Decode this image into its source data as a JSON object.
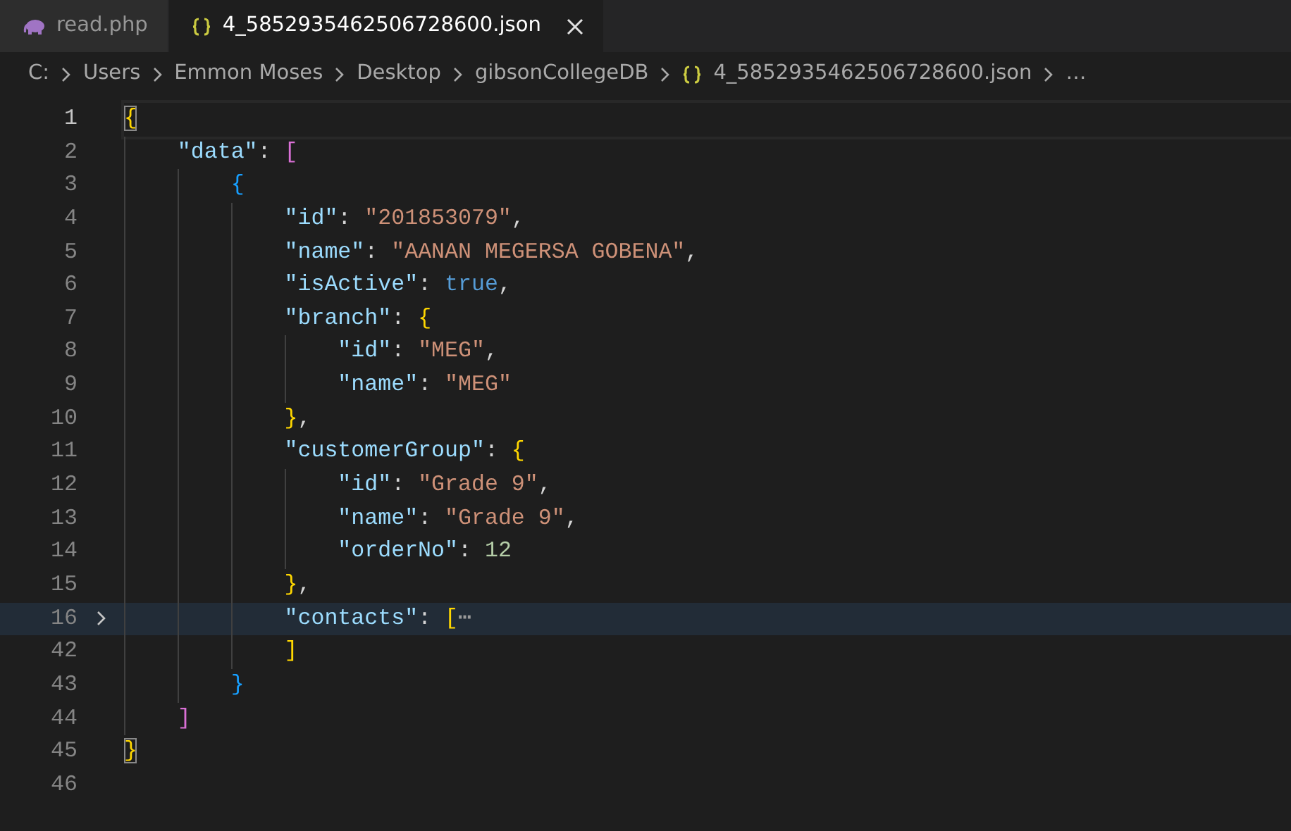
{
  "tabs": [
    {
      "label": "read.php",
      "kind": "php",
      "selected": false,
      "closable": false
    },
    {
      "label": "4_5852935462506728600.json",
      "kind": "json",
      "selected": true,
      "closable": true
    }
  ],
  "breadcrumb": [
    {
      "label": "C:",
      "kind": "folder"
    },
    {
      "label": "Users",
      "kind": "folder"
    },
    {
      "label": "Emmon Moses",
      "kind": "folder"
    },
    {
      "label": "Desktop",
      "kind": "folder"
    },
    {
      "label": "gibsonCollegeDB",
      "kind": "folder"
    },
    {
      "label": "4_5852935462506728600.json",
      "kind": "json"
    },
    {
      "label": "…",
      "kind": "more"
    }
  ],
  "editor": {
    "lines": [
      {
        "number": "1",
        "cursor": true,
        "highlighted": false,
        "folded": false,
        "tokens": [
          {
            "kind": "bracket",
            "text": "{",
            "color": "#ffd700",
            "matched": true
          }
        ],
        "children": [
          {
            "number": "2",
            "cursor": false,
            "highlighted": false,
            "folded": false,
            "tokens": [
              {
                "kind": "key",
                "text": "\"data\""
              },
              {
                "kind": "punct",
                "text": ": "
              },
              {
                "kind": "bracket",
                "text": "[",
                "color": "#da70d6",
                "matched": false
              }
            ],
            "children": [
              {
                "number": "3",
                "cursor": false,
                "highlighted": false,
                "folded": false,
                "tokens": [
                  {
                    "kind": "bracket",
                    "text": "{",
                    "color": "#179fff",
                    "matched": false
                  }
                ],
                "children": [
                  {
                    "number": "4",
                    "cursor": false,
                    "highlighted": false,
                    "folded": false,
                    "tokens": [
                      {
                        "kind": "key",
                        "text": "\"id\""
                      },
                      {
                        "kind": "punct",
                        "text": ": "
                      },
                      {
                        "kind": "string",
                        "text": "\"201853079\""
                      },
                      {
                        "kind": "punct",
                        "text": ","
                      }
                    ]
                  },
                  {
                    "number": "5",
                    "cursor": false,
                    "highlighted": false,
                    "folded": false,
                    "tokens": [
                      {
                        "kind": "key",
                        "text": "\"name\""
                      },
                      {
                        "kind": "punct",
                        "text": ": "
                      },
                      {
                        "kind": "string",
                        "text": "\"AANAN MEGERSA GOBENA\""
                      },
                      {
                        "kind": "punct",
                        "text": ","
                      }
                    ]
                  },
                  {
                    "number": "6",
                    "cursor": false,
                    "highlighted": false,
                    "folded": false,
                    "tokens": [
                      {
                        "kind": "key",
                        "text": "\"isActive\""
                      },
                      {
                        "kind": "punct",
                        "text": ": "
                      },
                      {
                        "kind": "keyword",
                        "text": "true"
                      },
                      {
                        "kind": "punct",
                        "text": ","
                      }
                    ]
                  },
                  {
                    "number": "7",
                    "cursor": false,
                    "highlighted": false,
                    "folded": false,
                    "tokens": [
                      {
                        "kind": "key",
                        "text": "\"branch\""
                      },
                      {
                        "kind": "punct",
                        "text": ": "
                      },
                      {
                        "kind": "bracket",
                        "text": "{",
                        "color": "#ffd700",
                        "matched": false
                      }
                    ],
                    "children": [
                      {
                        "number": "8",
                        "cursor": false,
                        "highlighted": false,
                        "folded": false,
                        "tokens": [
                          {
                            "kind": "key",
                            "text": "\"id\""
                          },
                          {
                            "kind": "punct",
                            "text": ": "
                          },
                          {
                            "kind": "string",
                            "text": "\"MEG\""
                          },
                          {
                            "kind": "punct",
                            "text": ","
                          }
                        ]
                      },
                      {
                        "number": "9",
                        "cursor": false,
                        "highlighted": false,
                        "folded": false,
                        "tokens": [
                          {
                            "kind": "key",
                            "text": "\"name\""
                          },
                          {
                            "kind": "punct",
                            "text": ": "
                          },
                          {
                            "kind": "string",
                            "text": "\"MEG\""
                          }
                        ]
                      }
                    ]
                  },
                  {
                    "number": "10",
                    "cursor": false,
                    "highlighted": false,
                    "folded": false,
                    "tokens": [
                      {
                        "kind": "bracket",
                        "text": "}",
                        "color": "#ffd700",
                        "matched": false
                      },
                      {
                        "kind": "punct",
                        "text": ","
                      }
                    ]
                  },
                  {
                    "number": "11",
                    "cursor": false,
                    "highlighted": false,
                    "folded": false,
                    "tokens": [
                      {
                        "kind": "key",
                        "text": "\"customerGroup\""
                      },
                      {
                        "kind": "punct",
                        "text": ": "
                      },
                      {
                        "kind": "bracket",
                        "text": "{",
                        "color": "#ffd700",
                        "matched": false
                      }
                    ],
                    "children": [
                      {
                        "number": "12",
                        "cursor": false,
                        "highlighted": false,
                        "folded": false,
                        "tokens": [
                          {
                            "kind": "key",
                            "text": "\"id\""
                          },
                          {
                            "kind": "punct",
                            "text": ": "
                          },
                          {
                            "kind": "string",
                            "text": "\"Grade 9\""
                          },
                          {
                            "kind": "punct",
                            "text": ","
                          }
                        ]
                      },
                      {
                        "number": "13",
                        "cursor": false,
                        "highlighted": false,
                        "folded": false,
                        "tokens": [
                          {
                            "kind": "key",
                            "text": "\"name\""
                          },
                          {
                            "kind": "punct",
                            "text": ": "
                          },
                          {
                            "kind": "string",
                            "text": "\"Grade 9\""
                          },
                          {
                            "kind": "punct",
                            "text": ","
                          }
                        ]
                      },
                      {
                        "number": "14",
                        "cursor": false,
                        "highlighted": false,
                        "folded": false,
                        "tokens": [
                          {
                            "kind": "key",
                            "text": "\"orderNo\""
                          },
                          {
                            "kind": "punct",
                            "text": ": "
                          },
                          {
                            "kind": "number",
                            "text": "12"
                          }
                        ]
                      }
                    ]
                  },
                  {
                    "number": "15",
                    "cursor": false,
                    "highlighted": false,
                    "folded": false,
                    "tokens": [
                      {
                        "kind": "bracket",
                        "text": "}",
                        "color": "#ffd700",
                        "matched": false
                      },
                      {
                        "kind": "punct",
                        "text": ","
                      }
                    ]
                  },
                  {
                    "number": "16",
                    "cursor": false,
                    "highlighted": true,
                    "folded": true,
                    "tokens": [
                      {
                        "kind": "key",
                        "text": "\"contacts\""
                      },
                      {
                        "kind": "punct",
                        "text": ": "
                      },
                      {
                        "kind": "bracket",
                        "text": "[",
                        "color": "#ffd700",
                        "matched": false
                      },
                      {
                        "kind": "fold",
                        "text": "⋯"
                      }
                    ]
                  },
                  {
                    "number": "42",
                    "cursor": false,
                    "highlighted": false,
                    "folded": false,
                    "tokens": [
                      {
                        "kind": "bracket",
                        "text": "]",
                        "color": "#ffd700",
                        "matched": false
                      }
                    ]
                  }
                ]
              },
              {
                "number": "43",
                "cursor": false,
                "highlighted": false,
                "folded": false,
                "tokens": [
                  {
                    "kind": "bracket",
                    "text": "}",
                    "color": "#179fff",
                    "matched": false
                  }
                ]
              }
            ]
          },
          {
            "number": "44",
            "cursor": false,
            "highlighted": false,
            "folded": false,
            "tokens": [
              {
                "kind": "bracket",
                "text": "]",
                "color": "#da70d6",
                "matched": false
              }
            ]
          }
        ]
      },
      {
        "number": "45",
        "cursor": false,
        "highlighted": false,
        "folded": false,
        "tokens": [
          {
            "kind": "bracket",
            "text": "}",
            "color": "#ffd700",
            "matched": true
          }
        ]
      },
      {
        "number": "46",
        "cursor": false,
        "highlighted": false,
        "folded": false
      }
    ]
  }
}
